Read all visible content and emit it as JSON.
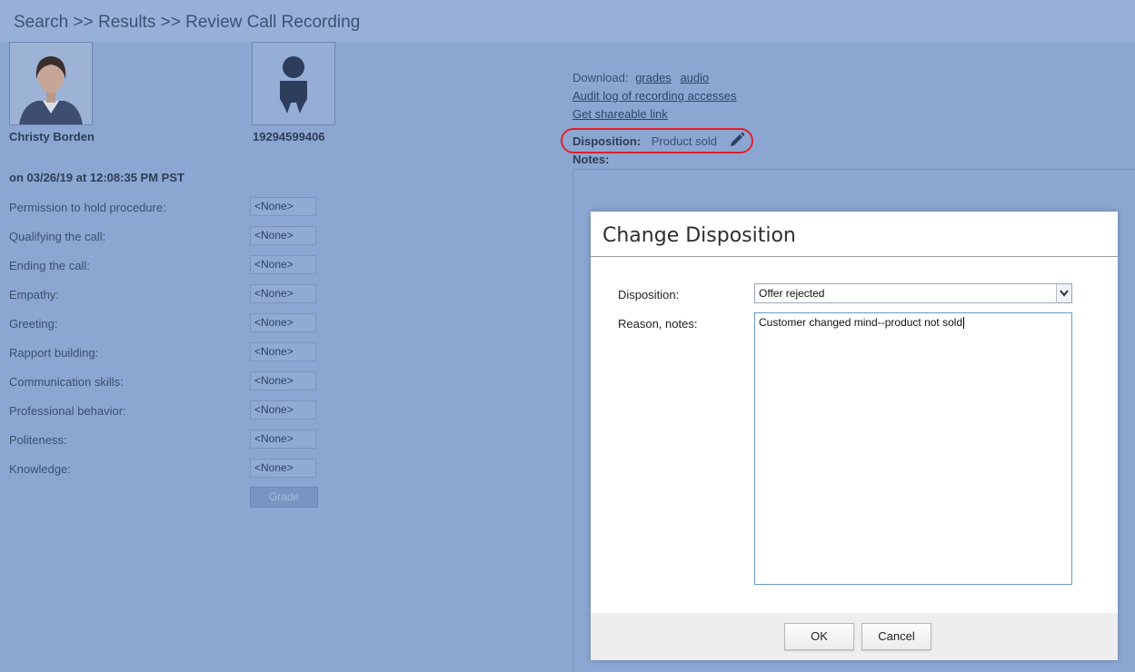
{
  "breadcrumb": {
    "search": "Search",
    "sep1": ">>",
    "results": "Results",
    "sep2": ">>",
    "current": "Review Call Recording"
  },
  "agent": {
    "name": "Christy Borden"
  },
  "caller": {
    "number": "19294599406"
  },
  "call_date": "on 03/26/19 at 12:08:35 PM PST",
  "criteria": [
    {
      "label": "Permission to hold procedure:",
      "value": "<None>"
    },
    {
      "label": "Qualifying the call:",
      "value": "<None>"
    },
    {
      "label": "Ending the call:",
      "value": "<None>"
    },
    {
      "label": "Empathy:",
      "value": "<None>"
    },
    {
      "label": "Greeting:",
      "value": "<None>"
    },
    {
      "label": "Rapport building:",
      "value": "<None>"
    },
    {
      "label": "Communication skills:",
      "value": "<None>"
    },
    {
      "label": "Professional behavior:",
      "value": "<None>"
    },
    {
      "label": "Politeness:",
      "value": "<None>"
    },
    {
      "label": "Knowledge:",
      "value": "<None>"
    }
  ],
  "grade_button": "Grade",
  "download": {
    "label": "Download:",
    "grades": "grades",
    "audio": "audio"
  },
  "links": {
    "audit": "Audit log of recording accesses",
    "share": "Get shareable link"
  },
  "disposition": {
    "label": "Disposition:",
    "value": "Product sold",
    "icon": "pencil-icon"
  },
  "notes_label": "Notes:",
  "modal": {
    "title": "Change Disposition",
    "disposition_label": "Disposition:",
    "disposition_value": "Offer rejected",
    "reason_label": "Reason, notes:",
    "reason_value": "Customer changed mind--product not sold",
    "ok": "OK",
    "cancel": "Cancel"
  },
  "colors": {
    "overlay_background": "#8ba7d1",
    "highlight_oval": "#e0202e",
    "modal_background": "#ffffff"
  }
}
